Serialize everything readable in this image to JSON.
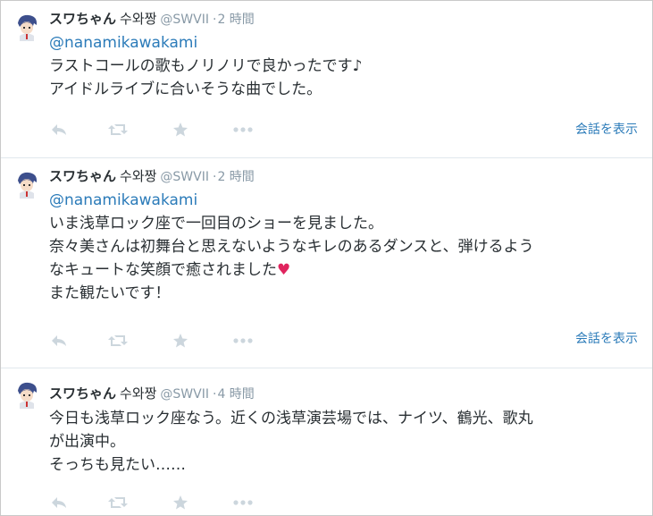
{
  "tweets": [
    {
      "fullname": "スワちゃん",
      "korean": "수와짱",
      "username": "@SWVII",
      "separator": "·",
      "time": "2 時間",
      "mention": "@nanamikawakami",
      "lines": [
        "ラストコールの歌もノリノリで良かったです♪",
        "アイドルライブに合いそうな曲でした。"
      ],
      "conversation_link": "会話を表示"
    },
    {
      "fullname": "スワちゃん",
      "korean": "수와짱",
      "username": "@SWVII",
      "separator": "·",
      "time": "2 時間",
      "mention": "@nanamikawakami",
      "lines": [
        "いま浅草ロック座で一回目のショーを見ました。",
        "奈々美さんは初舞台と思えないようなキレのあるダンスと、弾けるよう",
        "なキュートな笑顔で癒されました",
        "また観たいです！"
      ],
      "heart": "♥",
      "conversation_link": "会話を表示"
    },
    {
      "fullname": "スワちゃん",
      "korean": "수와짱",
      "username": "@SWVII",
      "separator": "·",
      "time": "4 時間",
      "lines": [
        "今日も浅草ロック座なう。近くの浅草演芸場では、ナイツ、鶴光、歌丸",
        "が出演中。",
        "そっちも見たい……"
      ]
    }
  ],
  "icons": {
    "reply": "reply-icon",
    "retweet": "retweet-icon",
    "favorite": "star-icon",
    "more": "more-icon"
  },
  "colors": {
    "link": "#2b7bb9",
    "meta": "#8899a6",
    "action_icon": "#ccd6dd",
    "heart": "#e0245e"
  }
}
